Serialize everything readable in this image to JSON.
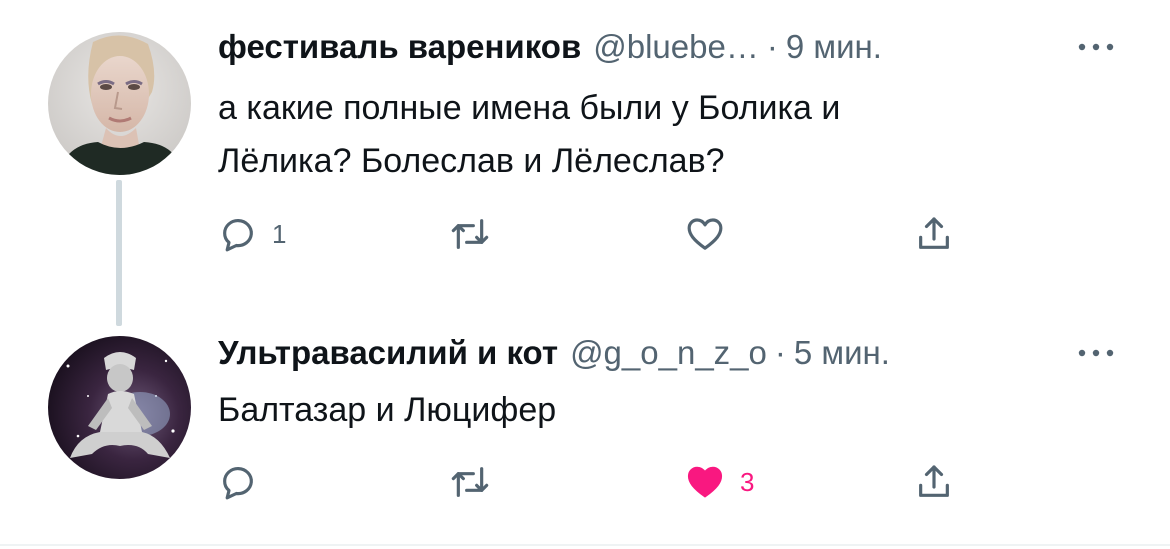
{
  "tweets": [
    {
      "author_name": "фестиваль вареников",
      "handle": "@bluebe…",
      "separator": "·",
      "time": "9 мин.",
      "text_lines": [
        "а какие полные имена были у Болика и",
        "Лёлика? Болеслав и Лёлеслав?"
      ],
      "reply_count": "1",
      "retweet_count": "",
      "like_count": "",
      "liked": false,
      "avatar_icon": "woman-portrait-avatar"
    },
    {
      "author_name": "Ультравасилий и кот",
      "handle": "@g_o_n_z_o",
      "separator": "·",
      "time": "5 мин.",
      "text_lines": [
        "Балтазар и Люцифер"
      ],
      "reply_count": "",
      "retweet_count": "",
      "like_count": "3",
      "liked": true,
      "avatar_icon": "cosmic-figure-avatar"
    }
  ],
  "icons": {
    "reply": "speech-bubble-icon",
    "retweet": "retweet-arrows-icon",
    "like": "heart-icon",
    "share": "share-upload-icon",
    "more": "ellipsis-icon"
  },
  "colors": {
    "text_primary": "#0f1419",
    "text_secondary": "#536471",
    "like_active": "#f91880",
    "thread_line": "#cfd9de"
  }
}
